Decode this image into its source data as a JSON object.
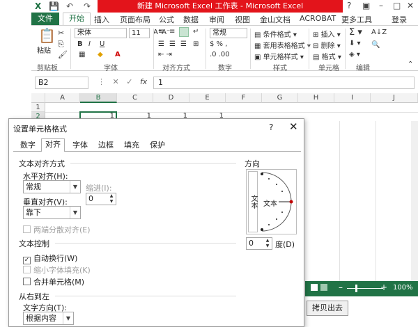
{
  "window": {
    "title": "新建 Microsoft Excel 工作表 - Microsoft Excel",
    "login": "登录"
  },
  "menu": {
    "file": "文件",
    "tabs": [
      "开始",
      "插入",
      "页面布局",
      "公式",
      "数据",
      "审阅",
      "视图",
      "金山文档",
      "ACROBAT",
      "更多工具"
    ]
  },
  "ribbon": {
    "paste": "粘贴",
    "font_name": "宋体",
    "font_size": "11",
    "bold": "B",
    "italic": "I",
    "underline": "U",
    "number_format": "常规",
    "cond_format": "条件格式",
    "table_format": "套用表格格式",
    "cell_style": "单元格样式",
    "insert": "插入",
    "delete": "删除",
    "format": "格式",
    "groups": [
      "剪贴板",
      "字体",
      "对齐方式",
      "数字",
      "样式",
      "单元格",
      "编辑"
    ]
  },
  "formula_bar": {
    "name_box": "B2",
    "fx": "fx",
    "value": "1"
  },
  "grid": {
    "columns": [
      "A",
      "B",
      "C",
      "D",
      "E",
      "F",
      "G",
      "H",
      "I",
      "J"
    ],
    "rows": [
      "1",
      "2"
    ],
    "values": [
      "1",
      "1",
      "1",
      "1"
    ]
  },
  "status": {
    "zoom": "100%"
  },
  "copy_button": "拷贝出去",
  "dialog": {
    "title": "设置单元格格式",
    "help": "?",
    "close": "✕",
    "tabs": [
      "数字",
      "对齐",
      "字体",
      "边框",
      "填充",
      "保护"
    ],
    "text_align_section": "文本对齐方式",
    "h_align_label": "水平对齐(H):",
    "h_align_value": "常规",
    "indent_label": "缩进(I):",
    "indent_value": "0",
    "v_align_label": "垂直对齐(V):",
    "v_align_value": "靠下",
    "justify_distributed": "两端分散对齐(E)",
    "text_control_section": "文本控制",
    "wrap_text": "自动换行(W)",
    "wrap_text_checked": true,
    "shrink_to_fit": "缩小字体填充(K)",
    "merge_cells": "合并单元格(M)",
    "rtl_section": "从右到左",
    "text_direction_label": "文字方向(T):",
    "text_direction_value": "根据内容",
    "orientation_section": "方向",
    "orientation_vertical_text": "文本",
    "orientation_text": "文本",
    "degrees_value": "0",
    "degrees_label": "度(D)"
  }
}
